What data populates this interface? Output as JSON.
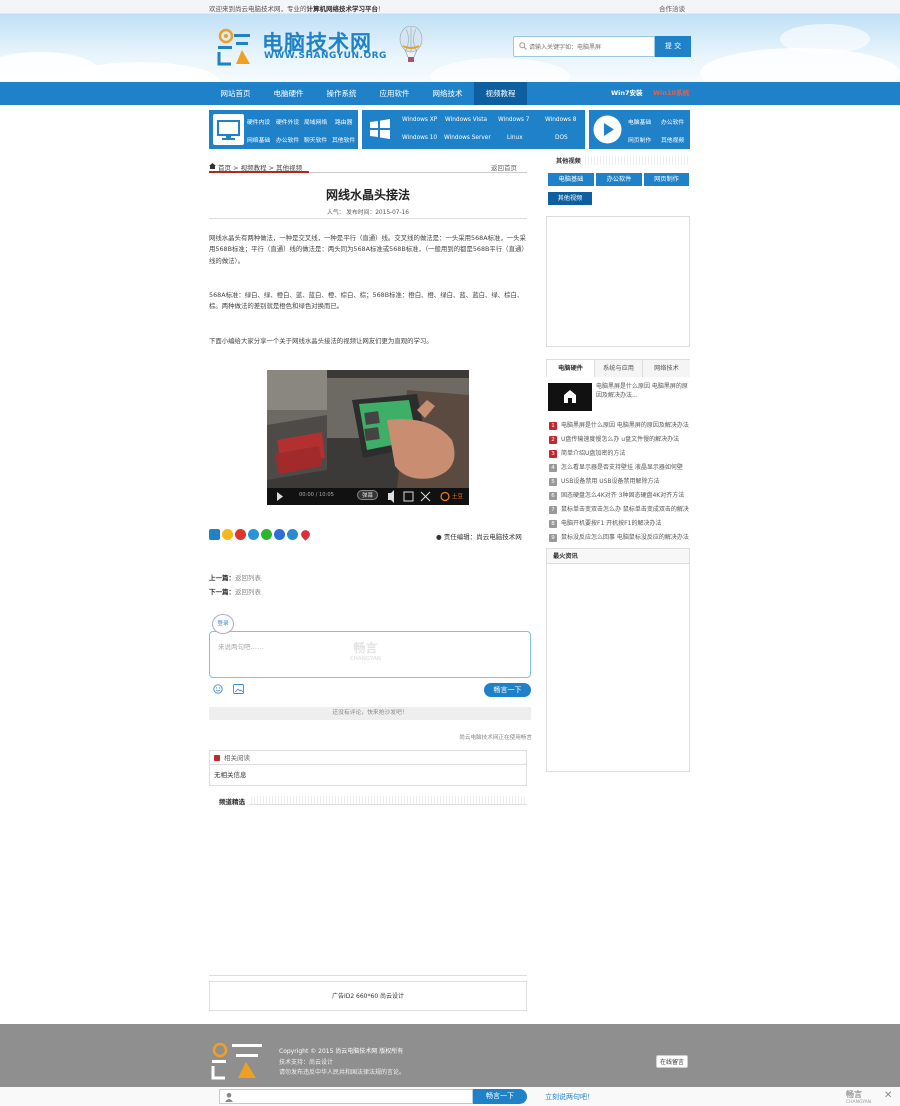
{
  "topbar": {
    "welcome_prefix": "欢迎来到尚云电脑技术网，专业的",
    "welcome_bold": "计算机网络技术学习平台",
    "welcome_suffix": "！",
    "right": "合作洽谈"
  },
  "header": {
    "logo_cn": "电脑技术网",
    "logo_en": "WWW.SHANGYUN.ORG",
    "search_placeholder": "请输入关键字如：电脑黑屏",
    "search_button": "提 交"
  },
  "nav": {
    "items": [
      "网站首页",
      "电脑硬件",
      "操作系统",
      "应用软件",
      "网络技术",
      "视频教程"
    ],
    "special1": "Win7安装",
    "special2": "Win10系统"
  },
  "subnav": {
    "hw": [
      "硬件内设",
      "硬件外设",
      "局域网络",
      "路由器",
      "网络基础",
      "办公软件",
      "聊天软件",
      "其他软件"
    ],
    "os": [
      "Windows XP",
      "Windows Vista",
      "Windows 7",
      "Windows 8",
      "Windows 10",
      "Windows Server",
      "Linux",
      "DOS"
    ],
    "video": [
      "电脑基础",
      "办公软件",
      "网页制作",
      "其他视频"
    ]
  },
  "breadcrumb": {
    "text": "首页 > 视频教程 > 其他视频",
    "back": "返回首页"
  },
  "article": {
    "title": "网线水晶头接法",
    "meta": "人气：  发布时间：2015-07-16",
    "p1": "网线水晶头有两种做法，一种是交叉线，一种是平行（直通）线。交叉线的做法是：一头采用568A标准，一头采用568B标准；平行（直通）线的做法是：两头同为568A标准或568B标准，（一般用到的都是568B平行（直通）线的做法）。",
    "p2": "568A标准：绿白、绿、橙白、蓝、蓝白、橙、棕白、棕；568B标准：橙白、橙、绿白、蓝、蓝白、绿、棕白、棕。两种做法的差别就是橙色和绿色对换而已。",
    "p3": "下面小编给大家分享一个关于网线水晶头接法的视频让网友们更为直观的学习。",
    "video_time": "00:00 / 10:05",
    "video_bullet": "弹幕",
    "video_brand": "土豆",
    "editor": "责任编辑：尚云电脑技术网",
    "prev_label": "上一篇：",
    "prev_val": "返回列表",
    "next_label": "下一篇：",
    "next_val": "返回列表"
  },
  "comment": {
    "login": "登录",
    "placeholder": "来说两句吧……",
    "watermark": "畅言",
    "watermark_en": "CHANGYAN",
    "submit": "畅言一下",
    "empty": "还没有评论，快来抢沙发吧！",
    "powered": "尚云电脑技术网正在使用畅言"
  },
  "related": {
    "title": "相关阅读",
    "body": "无相关信息"
  },
  "featured": {
    "title": "频道精选"
  },
  "ad": {
    "text": "广告ID2 660*60 尚云设计"
  },
  "sidebar": {
    "other_title": "其他视频",
    "tags": [
      "电脑基础",
      "办公软件",
      "网页制作",
      "其他视频"
    ],
    "tabs": [
      "电脑硬件",
      "系统与应用",
      "网络技术"
    ],
    "top_item": "电脑黑屏是什么原因 电脑黑屏的原因及解决办法...",
    "list": [
      {
        "n": "1",
        "t": "电脑黑屏是什么原因 电脑黑屏的原因及解决办法"
      },
      {
        "n": "2",
        "t": "U盘传输速度慢怎么办 u盘文件慢的解决办法"
      },
      {
        "n": "3",
        "t": "简单介绍U盘加密的方法"
      },
      {
        "n": "4",
        "t": "怎么看显示器是否支持壁挂 液晶显示器如何壁"
      },
      {
        "n": "5",
        "t": "USB设备禁用 USB设备禁用解除方法"
      },
      {
        "n": "6",
        "t": "固态硬盘怎么4K对齐 3种固态硬盘4K对齐方法"
      },
      {
        "n": "7",
        "t": "鼠标单击变双击怎么办 鼠标单击变成双击的解决"
      },
      {
        "n": "8",
        "t": "电脑开机要按F1 开机按F1的解决办法"
      },
      {
        "n": "9",
        "t": "鼠标没反应怎么回事 电脑鼠标没反应的解决办法"
      }
    ],
    "hot_title": "最火资讯"
  },
  "footer": {
    "copyright": "Copyright © 2015 尚云电脑技术网 版权所有",
    "support": "技术支持：尚云设计",
    "notice": "请勿发布违反中华人民共和国法律法规的言论。",
    "msg": "在线留言"
  },
  "bottombar": {
    "button": "畅言一下",
    "link": "立刻说两句吧！",
    "wm": "畅言",
    "wm_en": "CHANGYAN"
  },
  "colors": {
    "primary": "#1f82c8",
    "nav_active": "#0d5fa0",
    "red": "#c3262d",
    "footer": "#8f8f8f"
  }
}
